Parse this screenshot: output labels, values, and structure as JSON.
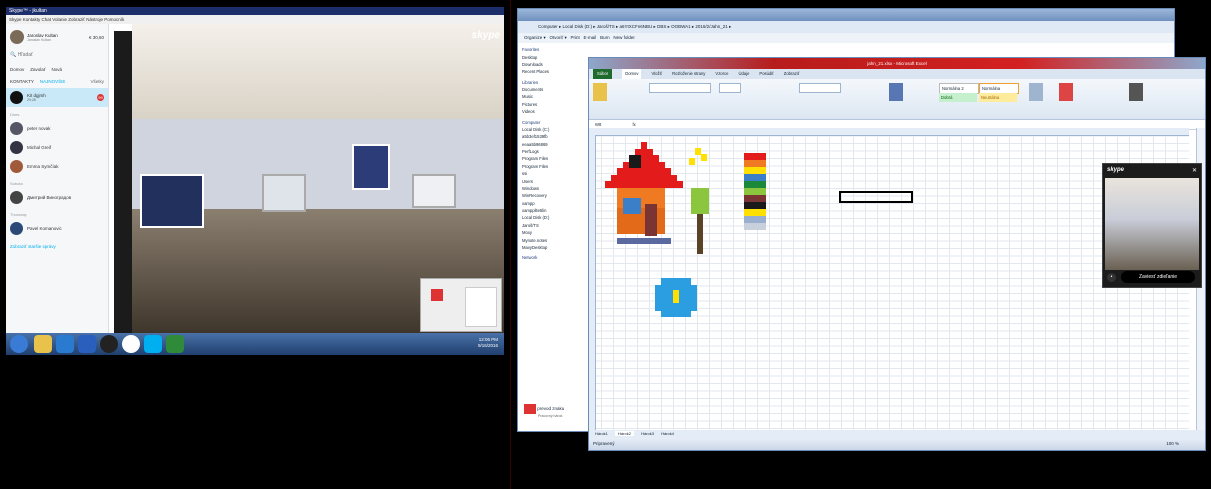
{
  "skype": {
    "title": "Skype™ - jkultan",
    "menu": "Skype   Kontakty   Chat   Volanie   Zobraziť   Nástroje   Pomocník",
    "profile_name": "Jaroslav Kultan",
    "profile_status": "Jaroslav Kultan",
    "credit": "€ 30,60",
    "search_placeholder": "Hľadať",
    "nav": [
      "Domov",
      "Zavolať",
      "Nová"
    ],
    "tabs": [
      "KONTAKTY",
      "NAJNOVŠIE",
      "Všetky"
    ],
    "contacts": [
      {
        "name": "Kit dgjmh",
        "sub": "29:28",
        "selected": true
      },
      {
        "name": "peter novak",
        "section": "Dnes"
      },
      {
        "name": "Michal Greif"
      },
      {
        "name": "Emma Symčíak"
      },
      {
        "name": "Дмитрий Виноградов",
        "section": "Sobota"
      },
      {
        "name": "Pavel Komanovic",
        "section": "Thursday"
      }
    ],
    "badge": "99",
    "link": "Zobraziť staršie správy",
    "logo": "skype"
  },
  "taskbar": {
    "time": "12:06 PM",
    "date": "9/16/2016"
  },
  "explorer": {
    "address": "Computer ▸ Local Disk (D:) ▸ Jaroš/TS ▸ a6YtXCFn6NBU ▸ DBS ▸ OOBWA1 ▸ 2016/2/Jahn_21 ▸",
    "toolbar": [
      "Organize ▾",
      "Otvoriť ▾",
      "Print",
      "E-mail",
      "Burn",
      "New folder"
    ],
    "nav": [
      {
        "label": "Favorites",
        "h": true
      },
      {
        "label": "Desktop"
      },
      {
        "label": "Downloads"
      },
      {
        "label": "Recent Places"
      },
      {
        "label": "Libraries",
        "h": true
      },
      {
        "label": "Documents"
      },
      {
        "label": "Music"
      },
      {
        "label": "Pictures"
      },
      {
        "label": "Videos"
      },
      {
        "label": "Computer",
        "h": true
      },
      {
        "label": "Local Disk (C:)"
      },
      {
        "label": "a5b3ef1539fb"
      },
      {
        "label": "eeaa5b96869"
      },
      {
        "label": "PerfLogs"
      },
      {
        "label": "Program Files"
      },
      {
        "label": "Program Files"
      },
      {
        "label": "ssi"
      },
      {
        "label": "Users"
      },
      {
        "label": "Windows"
      },
      {
        "label": "WinRecovery"
      },
      {
        "label": "xampp"
      },
      {
        "label": "xampplite5lin"
      },
      {
        "label": "Local Disk (D:)"
      },
      {
        "label": "Jaroš/TS"
      },
      {
        "label": "Moxy"
      },
      {
        "label": "Mynote.notes"
      },
      {
        "label": "MavyDesktop"
      },
      {
        "label": "Network",
        "h": true
      }
    ],
    "file_label": "prevod znaku",
    "file_sub": "Pracovný hárok"
  },
  "excel": {
    "title": "jahn_21.xlsx - Microsoft Excel",
    "tabs": [
      "Súbor",
      "Domov",
      "Vložiť",
      "Rozloženie strany",
      "Vzorce",
      "Údaje",
      "Posúdiť",
      "Zobraziť"
    ],
    "styles": [
      "Normálna 2",
      "Normálna",
      "Dobrá",
      "Neutrálna"
    ],
    "name_box": "W8",
    "sheets": [
      "Hárok1",
      "Hárok2",
      "Hárok3",
      "Hárok4"
    ],
    "status": "Pripravený",
    "zoom": "100 %"
  },
  "mini_window": {
    "button": "Zaviesť zdieľanie",
    "logo": "skype"
  }
}
